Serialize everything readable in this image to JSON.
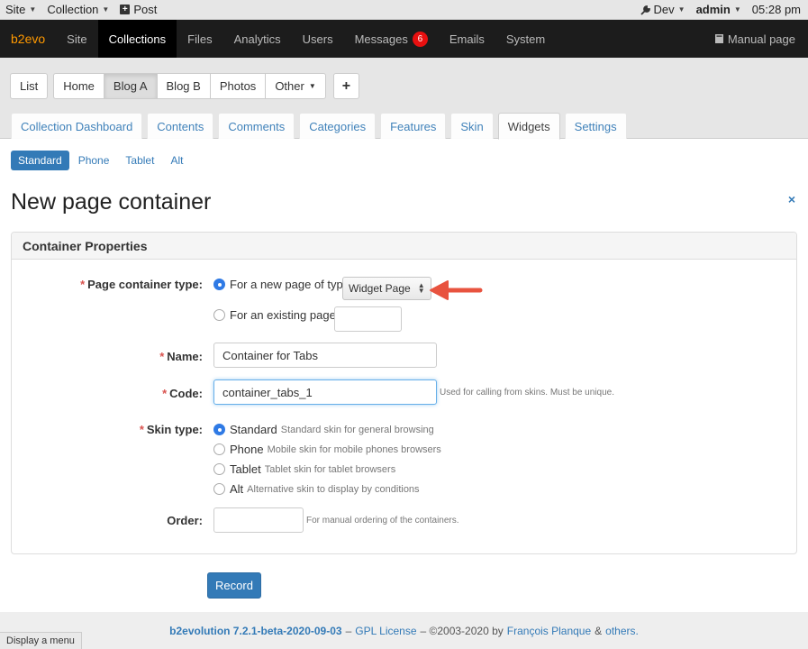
{
  "evobar": {
    "site": "Site",
    "collection": "Collection",
    "post": "Post",
    "dev": "Dev",
    "user": "admin",
    "time": "05:28 pm"
  },
  "mainnav": {
    "brand": "b2evo",
    "items": [
      "Site",
      "Collections",
      "Files",
      "Analytics",
      "Users",
      "Messages",
      "Emails",
      "System"
    ],
    "active": "Collections",
    "messages_badge": "6",
    "manual": "Manual page"
  },
  "collections": {
    "buttons": [
      "List",
      "Home",
      "Blog A",
      "Blog B",
      "Photos",
      "Other"
    ],
    "active": "Blog A",
    "add": "+"
  },
  "subtabs": {
    "items": [
      "Collection Dashboard",
      "Contents",
      "Comments",
      "Categories",
      "Features",
      "Skin",
      "Widgets",
      "Settings"
    ],
    "active": "Widgets"
  },
  "skins": {
    "items": [
      "Standard",
      "Phone",
      "Tablet",
      "Alt"
    ],
    "active": "Standard"
  },
  "page": {
    "title": "New page container",
    "close": "×"
  },
  "panel": {
    "title": "Container Properties",
    "type_label": "Page container type:",
    "type_new": "For a new page of type:",
    "type_select": "Widget Page",
    "type_existing": "For an existing page:",
    "name_label": "Name:",
    "name_value": "Container for Tabs",
    "code_label": "Code:",
    "code_value": "container_tabs_1",
    "code_hint": "Used for calling from skins. Must be unique.",
    "skin_label": "Skin type:",
    "skin_options": [
      {
        "label": "Standard",
        "note": "Standard skin for general browsing",
        "checked": true
      },
      {
        "label": "Phone",
        "note": "Mobile skin for mobile phones browsers",
        "checked": false
      },
      {
        "label": "Tablet",
        "note": "Tablet skin for tablet browsers",
        "checked": false
      },
      {
        "label": "Alt",
        "note": "Alternative skin to display by conditions",
        "checked": false
      }
    ],
    "order_label": "Order:",
    "order_value": "",
    "order_hint": "For manual ordering of the containers.",
    "required_mark": "*"
  },
  "record": "Record",
  "footer": {
    "product": "b2evolution 7.2.1-beta-2020-09-03",
    "sep1": "–",
    "license": "GPL License",
    "copy": "– ©2003-2020 by",
    "author": "François Planque",
    "amp": "&",
    "others": "others."
  },
  "statusbar": "Display a menu",
  "colors": {
    "accent": "#337ab7",
    "brand": "#ff9900",
    "badge": "#e81010",
    "arrow": "#e8533f"
  }
}
